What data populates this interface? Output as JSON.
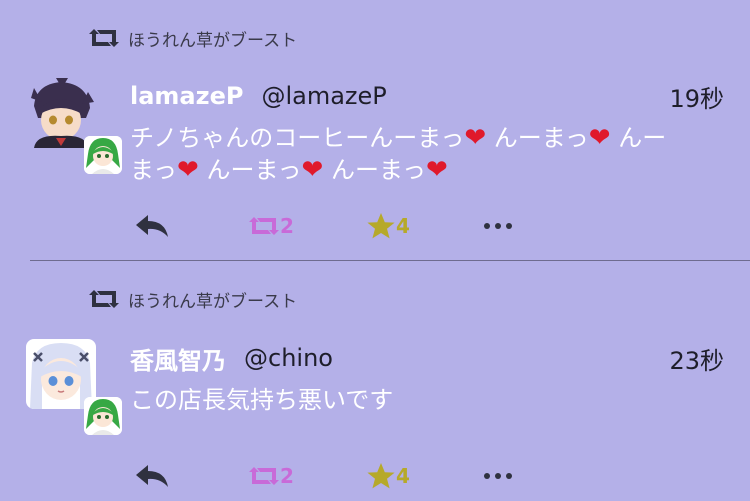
{
  "colors": {
    "background": "#b4b0e8",
    "boost_purple": "#c86ad8",
    "favourite_yellow": "#b6a92a",
    "heart_red": "#e0192b",
    "icon_dark": "#2f3140"
  },
  "posts": [
    {
      "boost_text": "ほうれん草がブースト",
      "display_name": "lamazeP",
      "username": "@lamazeP",
      "time": "19秒",
      "content_segments": [
        "チノちゃんのコーヒーんーまっ",
        "❤",
        " んーまっ",
        "❤",
        " んー",
        "まっ",
        "❤",
        " んーまっ",
        "❤",
        " んーまっ",
        "❤"
      ],
      "boost_count": "2",
      "favourite_count": "4",
      "icons": {
        "boost": "boost-icon",
        "reply": "reply-icon",
        "favourite": "star-icon",
        "more": "more-icon"
      }
    },
    {
      "boost_text": "ほうれん草がブースト",
      "display_name": "香風智乃",
      "username": "@chino",
      "time": "23秒",
      "content": "この店長気持ち悪いです",
      "boost_count": "2",
      "favourite_count": "4",
      "icons": {
        "boost": "boost-icon",
        "reply": "reply-icon",
        "favourite": "star-icon",
        "more": "more-icon"
      }
    }
  ]
}
